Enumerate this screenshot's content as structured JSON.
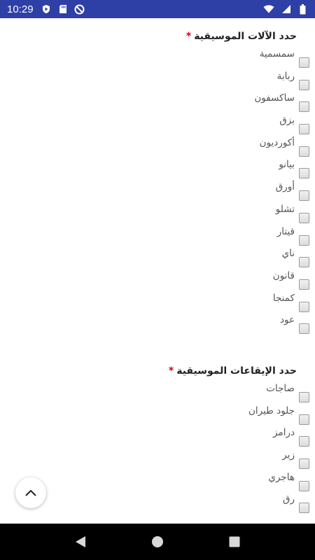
{
  "status_bar": {
    "time": "10:29",
    "left_icons": [
      "play-protect-icon",
      "sd-card-icon",
      "do-not-disturb-icon"
    ],
    "right_icons": [
      "wifi-icon",
      "signal-icon",
      "battery-icon"
    ],
    "background": "#2e3fa6"
  },
  "instruments": {
    "title": "حدد الآلات الموسيقية",
    "required_mark": "*",
    "options": [
      "سمسمية",
      "ربابة",
      "ساكسفون",
      "بزق",
      "أكورديون",
      "بيانو",
      "أورق",
      "تشلو",
      "قيتار",
      "ناي",
      "قانون",
      "كمنجا",
      "عود"
    ]
  },
  "rhythms": {
    "title": "حدد الإيقاعات الموسيقية",
    "required_mark": "*",
    "options": [
      "صاجات",
      "جلود طيران",
      "درامز",
      "زير",
      "هاجري",
      "رق"
    ]
  },
  "fab": {
    "icon": "chevron-up-icon"
  },
  "nav_bar": {
    "icons": [
      "back-icon",
      "home-icon",
      "recents-icon"
    ]
  },
  "colors": {
    "required": "#d0021b",
    "label": "#555555"
  }
}
